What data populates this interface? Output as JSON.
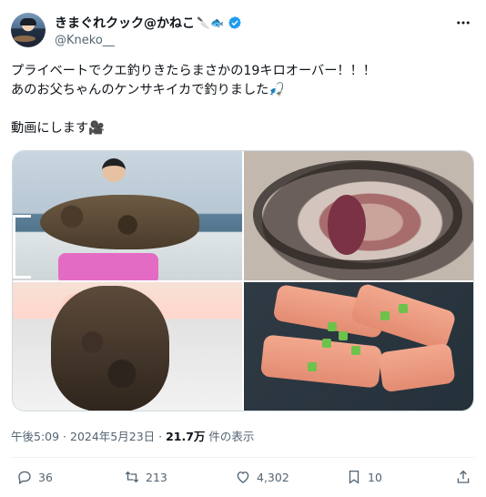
{
  "user": {
    "display_name": "きまぐれクック@かねこ",
    "display_emojis": "🔪🐟",
    "handle": "@Kneko__",
    "verified": true,
    "avatar_icon": "avatar-image"
  },
  "tweet": {
    "text": "プライベートでクエ釣りきたらまさかの19キロオーバー！！！\nあのお父ちゃんのケンサキイカで釣りました🎣\n\n動画にします🎥",
    "media": [
      {
        "alt": "Man holding a large grouper on a boat"
      },
      {
        "alt": "Open mouth of the grouper"
      },
      {
        "alt": "Grouper under a red light"
      },
      {
        "alt": "Grilled slices topped with green onion"
      }
    ]
  },
  "meta": {
    "timestamp": "午後5:09 · 2024年5月23日",
    "separator": " · ",
    "views_count": "21.7万",
    "views_label": " 件の表示"
  },
  "actions": {
    "reply_count": "36",
    "retweet_count": "213",
    "like_count": "4,302",
    "bookmark_count": "10"
  },
  "colors": {
    "text_primary": "#0f1419",
    "text_secondary": "#536471",
    "verified_blue": "#1d9bf0",
    "border": "#cfd9de"
  }
}
